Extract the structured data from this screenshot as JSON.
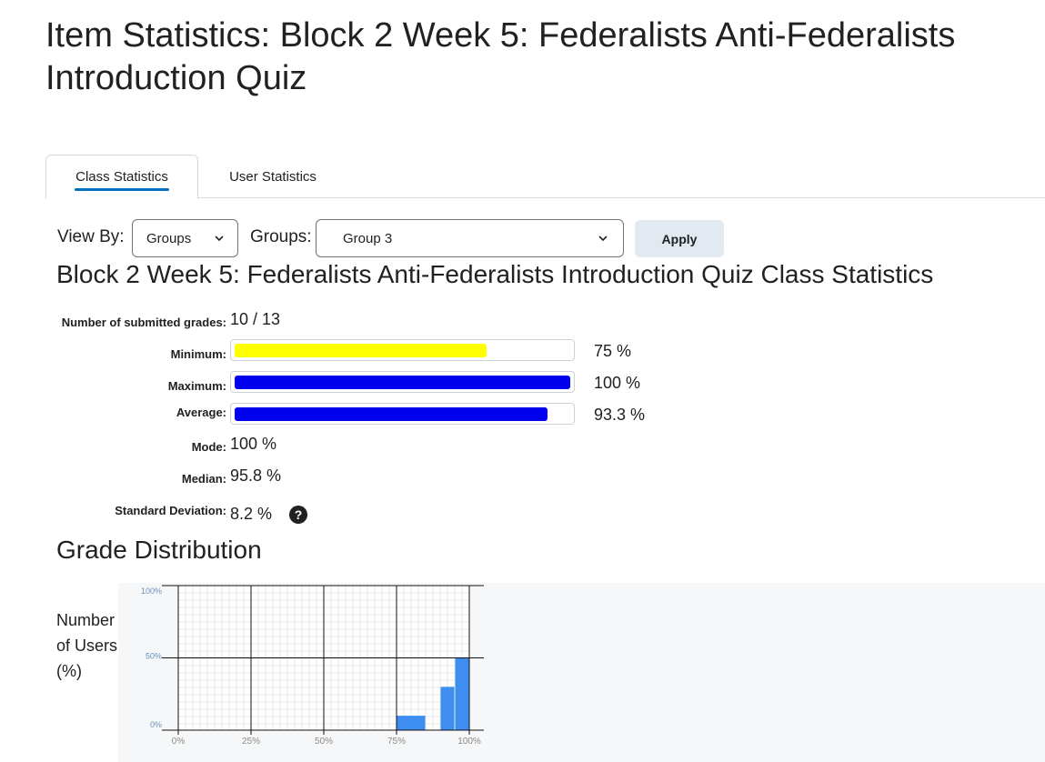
{
  "page": {
    "title": "Item Statistics: Block 2 Week 5: Federalists Anti-Federalists Introduction Quiz"
  },
  "tabs": [
    {
      "label": "Class Statistics",
      "active": true
    },
    {
      "label": "User Statistics",
      "active": false
    }
  ],
  "filters": {
    "view_by_label": "View By:",
    "view_by_value": "Groups",
    "groups_label": "Groups:",
    "groups_value": "Group 3",
    "apply_label": "Apply"
  },
  "stats": {
    "title": "Block 2 Week 5: Federalists Anti-Federalists Introduction Quiz Class Statistics",
    "submitted_label": "Number of submitted grades:",
    "submitted_value": "10 / 13",
    "minimum_label": "Minimum:",
    "minimum_value": "75 %",
    "minimum_pct": 75,
    "maximum_label": "Maximum:",
    "maximum_value": "100 %",
    "maximum_pct": 100,
    "average_label": "Average:",
    "average_value": "93.3 %",
    "average_pct": 93.3,
    "mode_label": "Mode:",
    "mode_value": "100 %",
    "median_label": "Median:",
    "median_value": "95.8 %",
    "stddev_label": "Standard Deviation:",
    "stddev_value": "8.2 %",
    "colors": {
      "minimum": "#ffff00",
      "maximum": "#0000ee",
      "average": "#0000ee"
    }
  },
  "distribution": {
    "title": "Grade Distribution",
    "y_title": "Number of Users (%)"
  },
  "chart_data": {
    "type": "bar",
    "title": "",
    "xlabel": "",
    "ylabel": "Number of Users (%)",
    "xlim": [
      0,
      100
    ],
    "ylim": [
      0,
      100
    ],
    "x_ticks": [
      "0%",
      "25%",
      "50%",
      "75%",
      "100%"
    ],
    "y_ticks": [
      "0%",
      "50%",
      "100%"
    ],
    "grid": true,
    "bar_color": "#3d8ef0",
    "bins": [
      {
        "from": 75,
        "to": 85,
        "value": 10
      },
      {
        "from": 90,
        "to": 95,
        "value": 30
      },
      {
        "from": 95,
        "to": 100,
        "value": 50
      }
    ]
  }
}
